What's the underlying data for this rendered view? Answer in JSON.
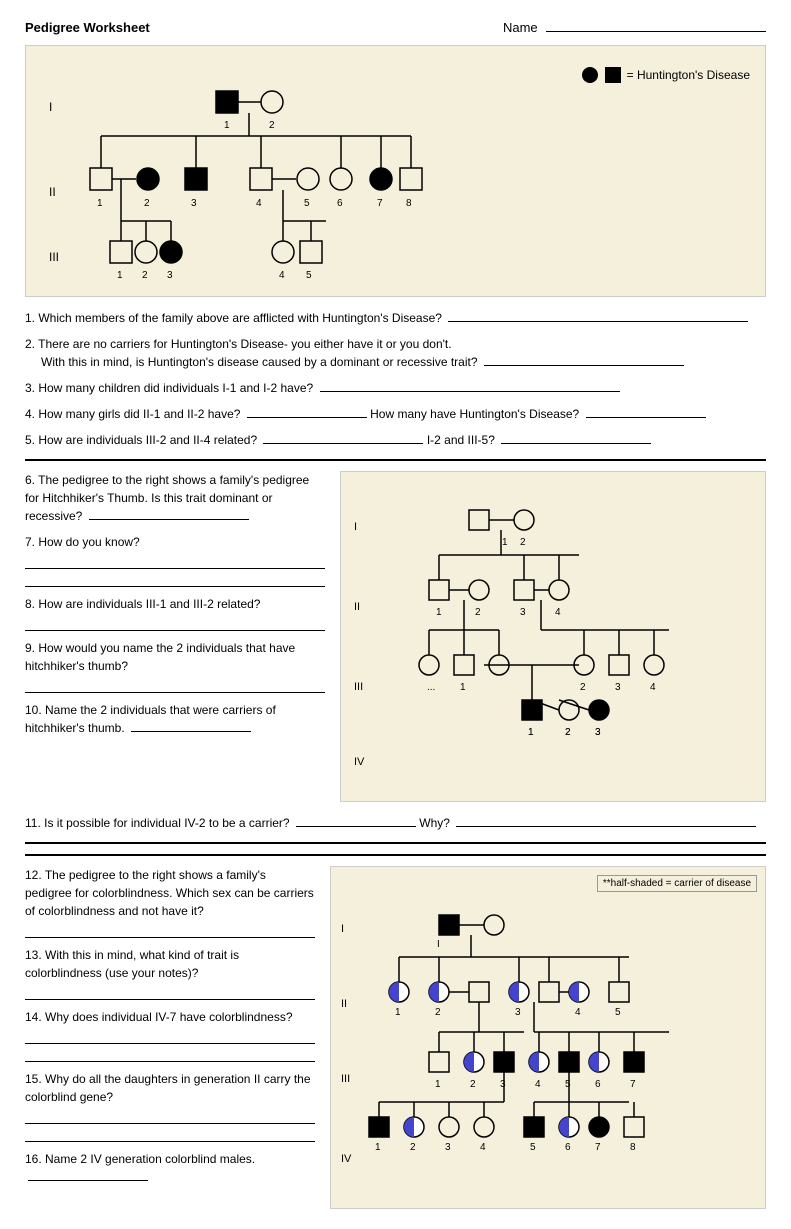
{
  "header": {
    "title": "Pedigree Worksheet",
    "name_label": "Name",
    "name_line": ""
  },
  "legend": {
    "text": "= Huntington's Disease"
  },
  "questions_section1": [
    {
      "number": "1.",
      "text": "Which members of the family above are afflicted with Huntington's Disease?"
    },
    {
      "number": "2.",
      "text1": "There are no carriers for Huntington's Disease- you either have it or you don't.",
      "text2": "With this in mind, is Huntington's disease caused by a dominant or recessive trait?"
    },
    {
      "number": "3.",
      "text": "How many children did individuals I-1 and I-2 have?"
    },
    {
      "number": "4.",
      "text1": "How many girls did II-1 and II-2 have?",
      "text2": "How many have Huntington's Disease?"
    },
    {
      "number": "5.",
      "text1": "How are individuals III-2 and II-4 related?",
      "text2": "I-2 and III-5?"
    }
  ],
  "questions_section2": [
    {
      "number": "6.",
      "text": "The pedigree to the right shows a family's pedigree for Hitchhiker's Thumb. Is this trait dominant or recessive?"
    },
    {
      "number": "7.",
      "text": "How do you know?"
    },
    {
      "number": "8.",
      "text": "How are individuals III-1 and III-2 related?"
    },
    {
      "number": "9.",
      "text": "How would you name the 2 individuals that have hitchhiker's thumb?"
    },
    {
      "number": "10.",
      "text": "Name the 2 individuals that were carriers of hitchhiker's thumb."
    },
    {
      "number": "11.",
      "text1": "Is it possible for individual IV-2 to be a carrier?",
      "text2": "Why?"
    }
  ],
  "questions_section3": [
    {
      "number": "12.",
      "text": "The pedigree to the right shows a family's pedigree for colorblindness.  Which sex can be carriers of colorblindness and not have it?"
    },
    {
      "number": "13.",
      "text": "With this in mind, what kind of trait is colorblindness (use your notes)?"
    },
    {
      "number": "14.",
      "text": "Why does individual IV-7 have colorblindness?"
    },
    {
      "number": "15.",
      "text": "Why do all the daughters in generation II carry the colorblind gene?"
    },
    {
      "number": "16.",
      "text": "Name 2 IV generation colorblind males."
    }
  ],
  "half_shaded_label": "**half-shaded = carrier of disease"
}
